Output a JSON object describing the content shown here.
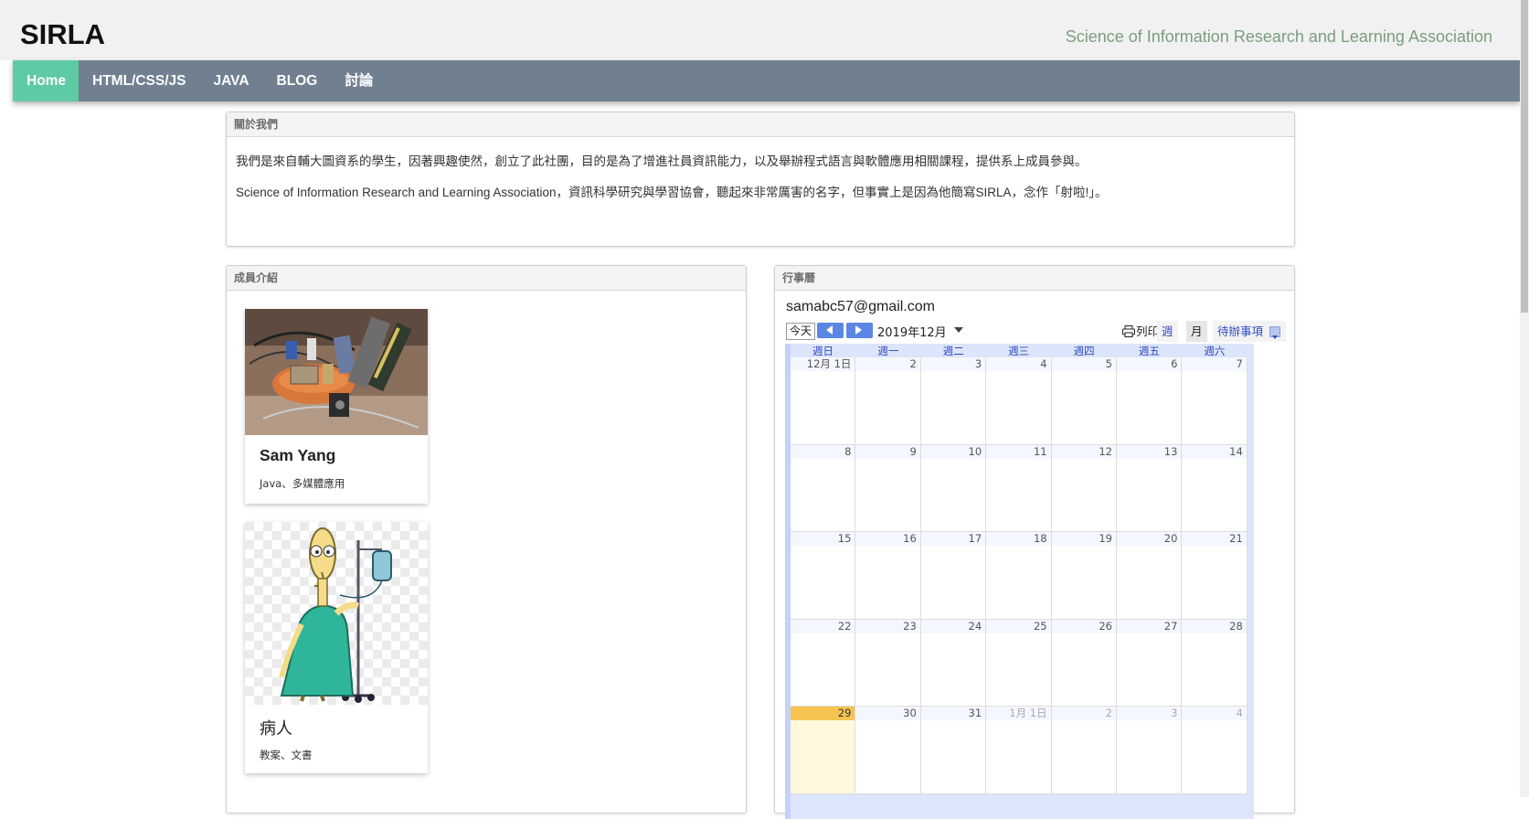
{
  "header": {
    "title": "SIRLA",
    "subtitle": "Science of Information Research and Learning Association"
  },
  "nav": {
    "items": [
      {
        "label": "Home",
        "active": true
      },
      {
        "label": "HTML/CSS/JS",
        "active": false
      },
      {
        "label": "JAVA",
        "active": false
      },
      {
        "label": "BLOG",
        "active": false
      },
      {
        "label": "討論",
        "active": false
      }
    ]
  },
  "about": {
    "heading": "關於我們",
    "paragraphs": [
      "我們是來自輔大圖資系的學生，因著興趣使然，創立了此社團，目的是為了增進社員資訊能力，以及舉辦程式語言與軟體應用相關課程，提供系上成員參與。",
      "Science of Information Research and Learning Association，資訊科學研究與學習協會，聽起來非常厲害的名字，但事實上是因為他簡寫SIRLA，念作「射啦!」。"
    ]
  },
  "members": {
    "heading": "成員介紹",
    "list": [
      {
        "name": "Sam Yang",
        "desc": "Java、多媒體應用",
        "photo_icon": "hardware-photo"
      },
      {
        "name": "病人",
        "desc": "教案、文書",
        "photo_icon": "patient-cartoon"
      }
    ]
  },
  "calendar": {
    "heading": "行事曆",
    "owner": "samabc57@gmail.com",
    "today_label": "今天",
    "month_label": "2019年12月",
    "print_label": "列印",
    "week_label": "週",
    "month_view_label": "月",
    "agenda_label": "待辦事項",
    "weekdays": [
      "週日",
      "週一",
      "週二",
      "週三",
      "週四",
      "週五",
      "週六"
    ],
    "weeks": [
      [
        "12月 1日",
        "2",
        "3",
        "4",
        "5",
        "6",
        "7"
      ],
      [
        "8",
        "9",
        "10",
        "11",
        "12",
        "13",
        "14"
      ],
      [
        "15",
        "16",
        "17",
        "18",
        "19",
        "20",
        "21"
      ],
      [
        "22",
        "23",
        "24",
        "25",
        "26",
        "27",
        "28"
      ],
      [
        "29",
        "30",
        "31",
        "1月 1日",
        "2",
        "3",
        "4"
      ]
    ],
    "today_cell": "29",
    "colors": {
      "accent": "#5b86e5",
      "today": "#f6c451",
      "nav": "#708090",
      "active_nav": "#5fcba4"
    }
  }
}
